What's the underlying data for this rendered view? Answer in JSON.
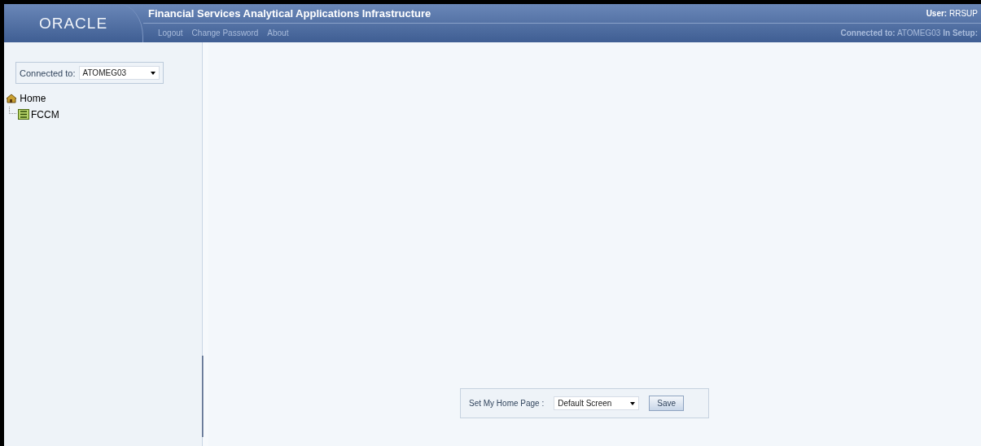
{
  "header": {
    "logo": "ORACLE",
    "title": "Financial Services Analytical Applications Infrastructure",
    "links": [
      "Logout",
      "Change Password",
      "About"
    ],
    "user_label": "User:",
    "user_value": "RRSUP",
    "connected_label": "Connected to:",
    "connected_value": "ATOMEG03",
    "setup_label": "In Setup:"
  },
  "sidebar": {
    "connected_label": "Connected to:",
    "connected_value": "ATOMEG03",
    "tree": [
      {
        "label": "Home",
        "children": [
          {
            "label": "FCCM"
          }
        ]
      }
    ]
  },
  "home_page": {
    "label": "Set My Home Page :",
    "value": "Default Screen",
    "button": "Save"
  }
}
